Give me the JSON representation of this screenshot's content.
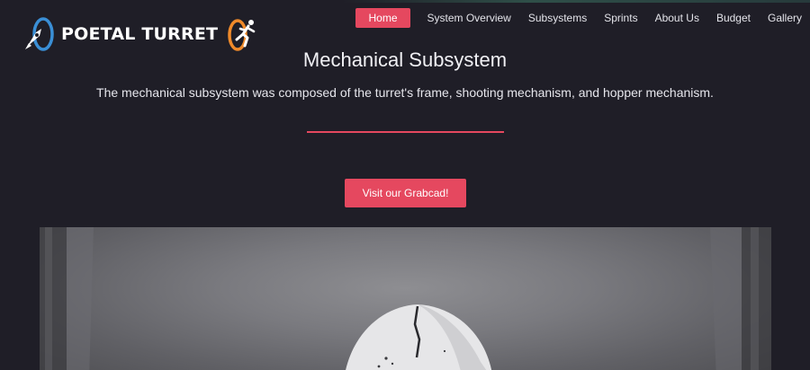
{
  "brand": {
    "name": "POETAL TURRET",
    "accent_color": "#e5485f",
    "left_logo_icon": "rocket-portal-icon",
    "right_logo_icon": "running-figure-portal-icon"
  },
  "nav": {
    "items": [
      {
        "label": "Home",
        "active": true
      },
      {
        "label": "System Overview",
        "active": false
      },
      {
        "label": "Subsystems",
        "active": false
      },
      {
        "label": "Sprints",
        "active": false
      },
      {
        "label": "About Us",
        "active": false
      },
      {
        "label": "Budget",
        "active": false
      },
      {
        "label": "Gallery",
        "active": false
      }
    ]
  },
  "main": {
    "title": "Mechanical Subsystem",
    "description": "The mechanical subsystem was composed of the turret's frame, shooting mechanism, and hopper mechanism.",
    "cta_label": "Visit our Grabcad!",
    "photo_subject": "turret-photo"
  }
}
